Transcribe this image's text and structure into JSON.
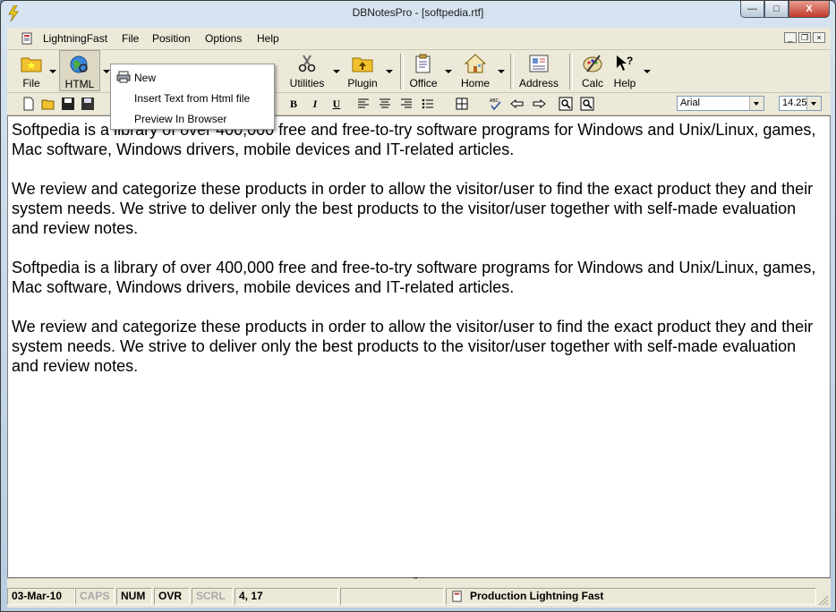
{
  "window": {
    "title": "DBNotesPro - [softpedia.rtf]",
    "controls": {
      "minimize": "—",
      "maximize": "□",
      "close": "X"
    }
  },
  "menubar": {
    "items": [
      "LightningFast",
      "File",
      "Position",
      "Options",
      "Help"
    ],
    "mdi_controls": [
      "_",
      "❐",
      "×"
    ]
  },
  "toolbar_big": {
    "buttons": [
      {
        "label": "File",
        "icon": "folder-star-icon"
      },
      {
        "label": "HTML",
        "icon": "globe-icon"
      },
      {
        "label": "Utilities",
        "icon": "scissors-icon"
      },
      {
        "label": "Plugin",
        "icon": "plugin-folder-icon"
      },
      {
        "label": "Office",
        "icon": "clipboard-icon"
      },
      {
        "label": "Home",
        "icon": "house-icon"
      },
      {
        "label": "Address",
        "icon": "address-card-icon"
      },
      {
        "label": "Calc",
        "icon": "calculator-icon"
      },
      {
        "label": "Help",
        "icon": "help-cursor-icon"
      }
    ]
  },
  "toolbar_small": {
    "bold": "B",
    "italic": "I",
    "underline": "U",
    "font": "Arial",
    "size": "14.25"
  },
  "popup_menu": {
    "items": [
      "New",
      "Insert Text from Html file",
      "Preview In Browser"
    ]
  },
  "document": {
    "paragraphs": [
      "Softpedia is a library of over 400,000 free and free-to-try software programs for Windows and Unix/Linux, games, Mac software, Windows drivers, mobile devices and IT-related articles.",
      "We review and categorize these products in order to allow the visitor/user to find the exact product they and their system needs. We strive to deliver only the best products to the visitor/user together with self-made evaluation and review notes.",
      "Softpedia is a library of over 400,000 free and free-to-try software programs for Windows and Unix/Linux, games, Mac software, Windows drivers, mobile devices and IT-related articles.",
      "We review and categorize these products in order to allow the visitor/user to find the exact product they and their system needs. We strive to deliver only the best products to the visitor/user together with self-made evaluation and review notes."
    ]
  },
  "scrollbar": {
    "grip": "'''"
  },
  "statusbar": {
    "date": "03-Mar-10",
    "caps": "CAPS",
    "num": "NUM",
    "ovr": "OVR",
    "scrl": "SCRL",
    "position": "4, 17",
    "mode": "Production Lightning Fast"
  },
  "colors": {
    "title_gradient": "#d6e3f0",
    "close_button": "#c0392b",
    "chrome": "#ece9d8"
  }
}
